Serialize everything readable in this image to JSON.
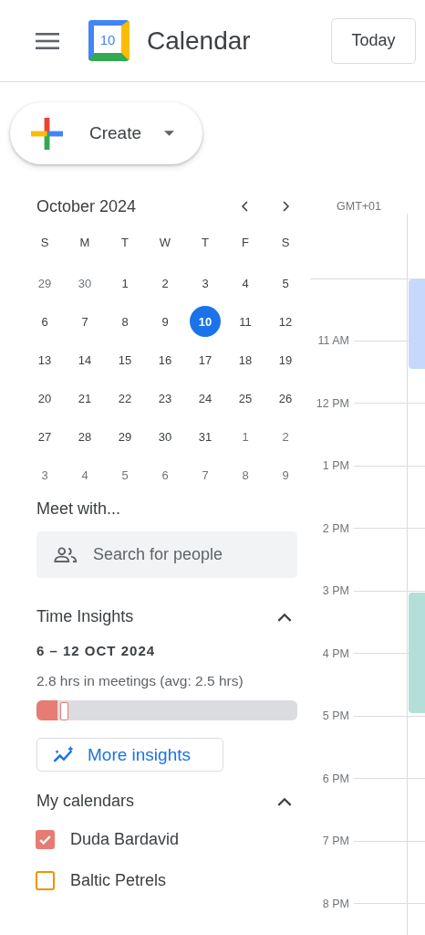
{
  "header": {
    "logo_day": "10",
    "title": "Calendar",
    "today_button": "Today"
  },
  "create_button": {
    "label": "Create"
  },
  "mini_calendar": {
    "month": "October 2024",
    "weekdays": [
      "S",
      "M",
      "T",
      "W",
      "T",
      "F",
      "S"
    ],
    "weeks": [
      [
        {
          "day": "29",
          "muted": true,
          "selected": false
        },
        {
          "day": "30",
          "muted": true,
          "selected": false
        },
        {
          "day": "1",
          "muted": false,
          "selected": false
        },
        {
          "day": "2",
          "muted": false,
          "selected": false
        },
        {
          "day": "3",
          "muted": false,
          "selected": false
        },
        {
          "day": "4",
          "muted": false,
          "selected": false
        },
        {
          "day": "5",
          "muted": false,
          "selected": false
        }
      ],
      [
        {
          "day": "6",
          "muted": false,
          "selected": false
        },
        {
          "day": "7",
          "muted": false,
          "selected": false
        },
        {
          "day": "8",
          "muted": false,
          "selected": false
        },
        {
          "day": "9",
          "muted": false,
          "selected": false
        },
        {
          "day": "10",
          "muted": false,
          "selected": true
        },
        {
          "day": "11",
          "muted": false,
          "selected": false
        },
        {
          "day": "12",
          "muted": false,
          "selected": false
        }
      ],
      [
        {
          "day": "13",
          "muted": false,
          "selected": false
        },
        {
          "day": "14",
          "muted": false,
          "selected": false
        },
        {
          "day": "15",
          "muted": false,
          "selected": false
        },
        {
          "day": "16",
          "muted": false,
          "selected": false
        },
        {
          "day": "17",
          "muted": false,
          "selected": false
        },
        {
          "day": "18",
          "muted": false,
          "selected": false
        },
        {
          "day": "19",
          "muted": false,
          "selected": false
        }
      ],
      [
        {
          "day": "20",
          "muted": false,
          "selected": false
        },
        {
          "day": "21",
          "muted": false,
          "selected": false
        },
        {
          "day": "22",
          "muted": false,
          "selected": false
        },
        {
          "day": "23",
          "muted": false,
          "selected": false
        },
        {
          "day": "24",
          "muted": false,
          "selected": false
        },
        {
          "day": "25",
          "muted": false,
          "selected": false
        },
        {
          "day": "26",
          "muted": false,
          "selected": false
        }
      ],
      [
        {
          "day": "27",
          "muted": false,
          "selected": false
        },
        {
          "day": "28",
          "muted": false,
          "selected": false
        },
        {
          "day": "29",
          "muted": false,
          "selected": false
        },
        {
          "day": "30",
          "muted": false,
          "selected": false
        },
        {
          "day": "31",
          "muted": false,
          "selected": false
        },
        {
          "day": "1",
          "muted": true,
          "selected": false
        },
        {
          "day": "2",
          "muted": true,
          "selected": false
        }
      ],
      [
        {
          "day": "3",
          "muted": true,
          "selected": false
        },
        {
          "day": "4",
          "muted": true,
          "selected": false
        },
        {
          "day": "5",
          "muted": true,
          "selected": false
        },
        {
          "day": "6",
          "muted": true,
          "selected": false
        },
        {
          "day": "7",
          "muted": true,
          "selected": false
        },
        {
          "day": "8",
          "muted": true,
          "selected": false
        },
        {
          "day": "9",
          "muted": true,
          "selected": false
        }
      ]
    ]
  },
  "meet_with": {
    "title": "Meet with...",
    "search": {
      "placeholder": "Search for people"
    }
  },
  "time_insights": {
    "title": "Time Insights",
    "expanded": true,
    "date_range": "6 – 12 OCT 2024",
    "summary": "2.8 hrs in meetings (avg: 2.5 hrs)",
    "level": 0.08,
    "button": "More insights"
  },
  "my_calendars": {
    "title": "My calendars",
    "expanded": true,
    "items": [
      {
        "name": "Duda Bardavid",
        "checked": true,
        "color": "#e67c73"
      },
      {
        "name": "Baltic Petrels",
        "checked": false,
        "color": "#f09300"
      }
    ]
  },
  "timeline": {
    "timezone": "GMT+01",
    "hours": [
      "11 AM",
      "12 PM",
      "1 PM",
      "2 PM",
      "3 PM",
      "4 PM",
      "5 PM",
      "6 PM",
      "7 PM",
      "8 PM"
    ],
    "events": [
      {
        "color": "#c6d8fb"
      },
      {
        "color": "#b3dfd8"
      }
    ]
  }
}
